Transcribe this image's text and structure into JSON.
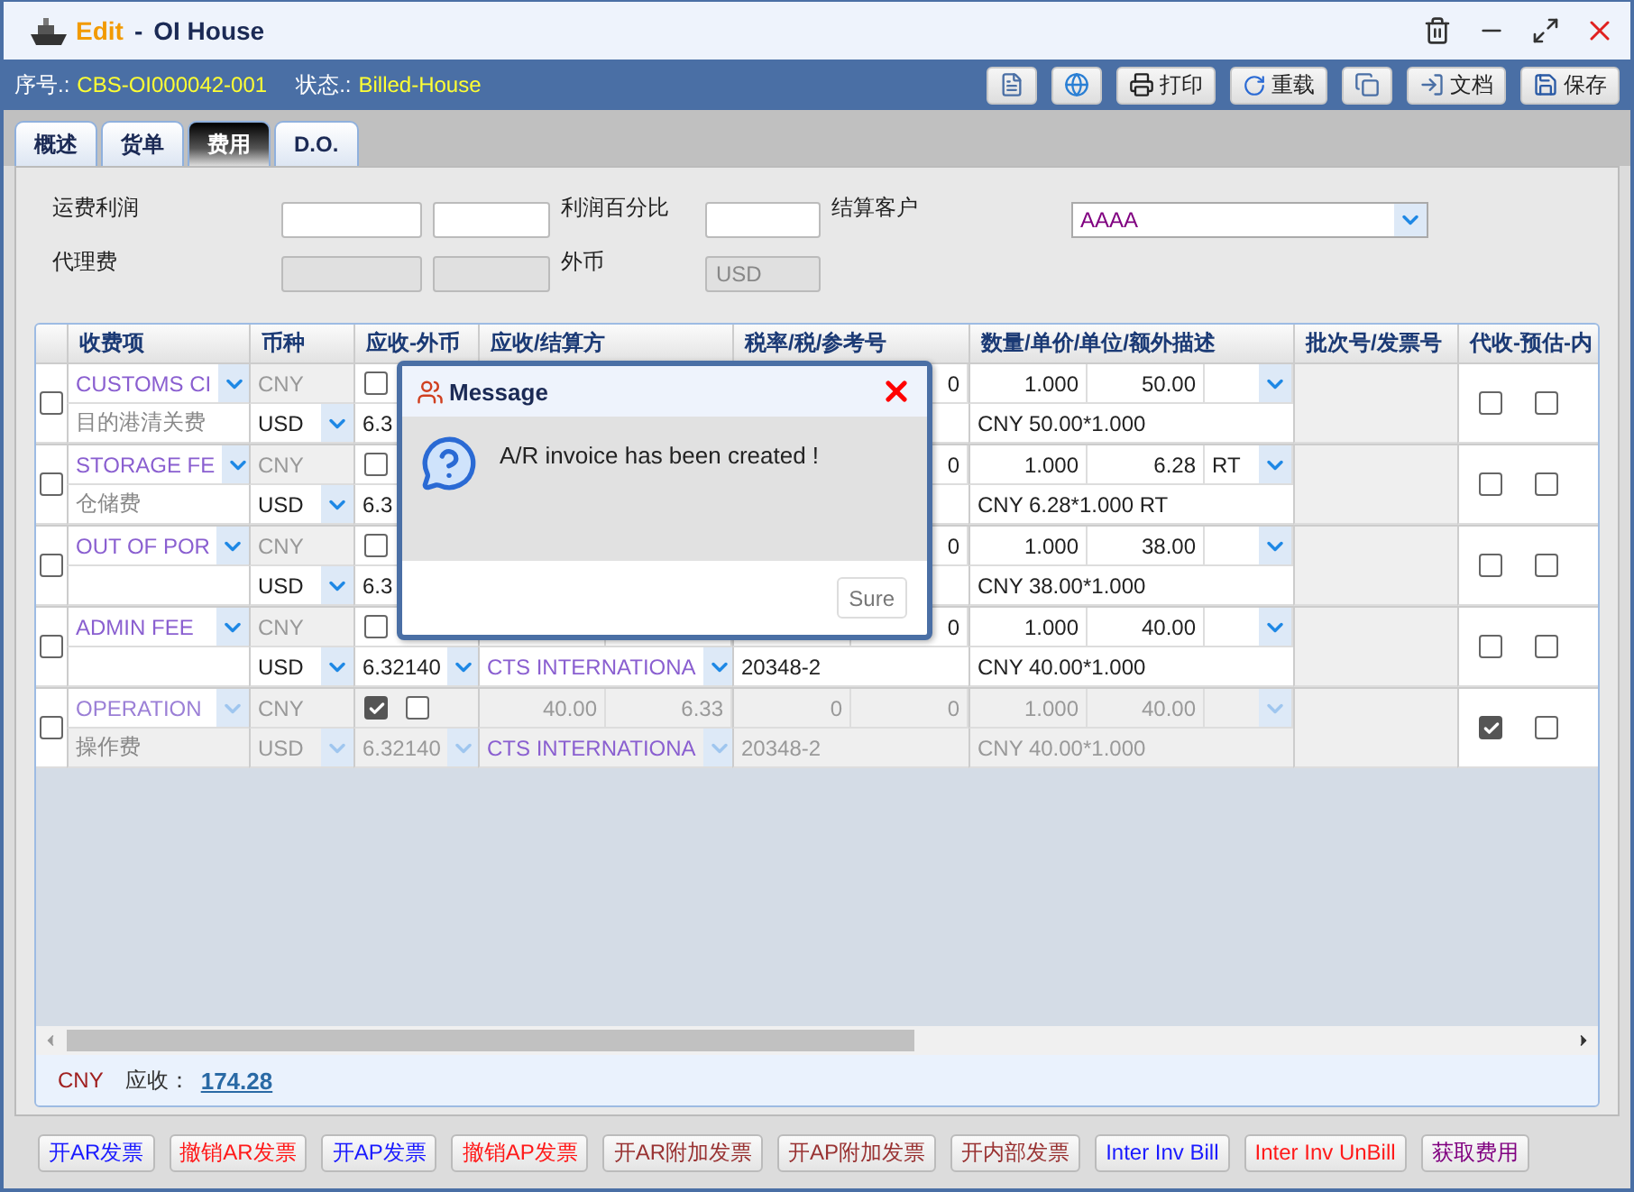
{
  "window": {
    "action": "Edit",
    "separator": "-",
    "title": "OI House"
  },
  "header": {
    "serial_label": "序号.:",
    "serial": "CBS-OI000042-001",
    "status_label": "状态.:",
    "status": "Billed-House"
  },
  "toolbar": [
    {
      "kind": "document"
    },
    {
      "kind": "globe"
    },
    {
      "kind": "print",
      "label": "打印"
    },
    {
      "kind": "reload",
      "label": "重载"
    },
    {
      "kind": "copy"
    },
    {
      "kind": "import",
      "label": "文档"
    },
    {
      "kind": "save",
      "label": "保存"
    }
  ],
  "tabs": [
    {
      "label": "概述",
      "selected": false
    },
    {
      "label": "货单",
      "selected": false
    },
    {
      "label": "费用",
      "selected": true
    },
    {
      "label": "D.O.",
      "selected": false
    }
  ],
  "form": {
    "profit_label": "运费利润",
    "percent_label": "利润百分比",
    "customer_label": "结算客户",
    "customer": "AAAA",
    "agency_label": "代理费",
    "foreign_label": "外币",
    "foreign": "USD"
  },
  "table": {
    "columns": [
      "收费项",
      "币种",
      "应收-外币",
      "应收/结算方",
      "税率/税/参考号",
      "数量/单价/单位/额外描述",
      "批次号/发票号",
      "代收-预估-内"
    ],
    "rows": [
      {
        "checked": false,
        "disabled": false,
        "item": "CUSTOMS CI",
        "item_note": "目的港清关费",
        "currency_base": "CNY",
        "currency": "USD",
        "foreign": [
          false
        ],
        "rate": "6.3",
        "rate_menu": false,
        "tax2": "0",
        "qty": "1.000",
        "price": "50.00",
        "desc": "CNY 50.00*1.000",
        "flags": [
          false,
          false
        ]
      },
      {
        "checked": false,
        "disabled": false,
        "item": "STORAGE FE",
        "item_note": "仓储费",
        "currency_base": "CNY",
        "currency": "USD",
        "foreign": [
          false
        ],
        "rate": "6.3",
        "rate_menu": false,
        "tax2": "0",
        "qty": "1.000",
        "price": "6.28",
        "unit": "RT",
        "desc": "CNY 6.28*1.000 RT",
        "flags": [
          false,
          false
        ]
      },
      {
        "checked": false,
        "disabled": false,
        "item": "OUT OF POR",
        "currency_base": "CNY",
        "currency": "USD",
        "foreign": [
          false
        ],
        "rate": "6.3",
        "rate_menu": false,
        "tax2": "0",
        "qty": "1.000",
        "price": "38.00",
        "desc": "CNY 38.00*1.000",
        "flags": [
          false,
          false
        ]
      },
      {
        "checked": false,
        "disabled": false,
        "item": "ADMIN FEE",
        "currency_base": "CNY",
        "currency": "USD",
        "foreign": [
          false
        ],
        "rate": "6.32140",
        "rate_menu": true,
        "party": "CTS INTERNATIONA",
        "ref": "20348-2",
        "tax2": "0",
        "qty": "1.000",
        "price": "40.00",
        "desc": "CNY 40.00*1.000",
        "flags": [
          false,
          false
        ]
      },
      {
        "checked": false,
        "disabled": true,
        "item": "OPERATION",
        "item_note": "操作费",
        "currency_base": "CNY",
        "currency": "USD",
        "foreign": [
          true,
          false
        ],
        "amount": "40.00",
        "amount2": "6.33",
        "rate": "6.32140",
        "rate_menu": true,
        "party": "CTS INTERNATIONA",
        "tax1": "0",
        "ref": "20348-2",
        "tax2": "0",
        "qty": "1.000",
        "price": "40.00",
        "desc": "CNY 40.00*1.000",
        "flags": [
          true,
          false
        ]
      }
    ]
  },
  "footer": {
    "currency": "CNY",
    "receivable_label": "应收：",
    "receivable": "174.28"
  },
  "dialog": {
    "title": "Message",
    "message": "A/R invoice has been created !",
    "button": "Sure"
  },
  "actions": [
    {
      "label": "开AR发票",
      "color": "#1a1aff"
    },
    {
      "label": "撤销AR发票",
      "color": "#ff1a1a"
    },
    {
      "label": "开AP发票",
      "color": "#1a1aff"
    },
    {
      "label": "撤销AP发票",
      "color": "#ff1a1a"
    },
    {
      "label": "开AR附加发票",
      "color": "#993333"
    },
    {
      "label": "开AP附加发票",
      "color": "#993333"
    },
    {
      "label": "开内部发票",
      "color": "#993333"
    },
    {
      "label": "Inter Inv Bill",
      "color": "#1a1aff"
    },
    {
      "label": "Inter Inv UnBill",
      "color": "#ff1a1a"
    },
    {
      "label": "获取费用",
      "color": "#800080"
    }
  ]
}
